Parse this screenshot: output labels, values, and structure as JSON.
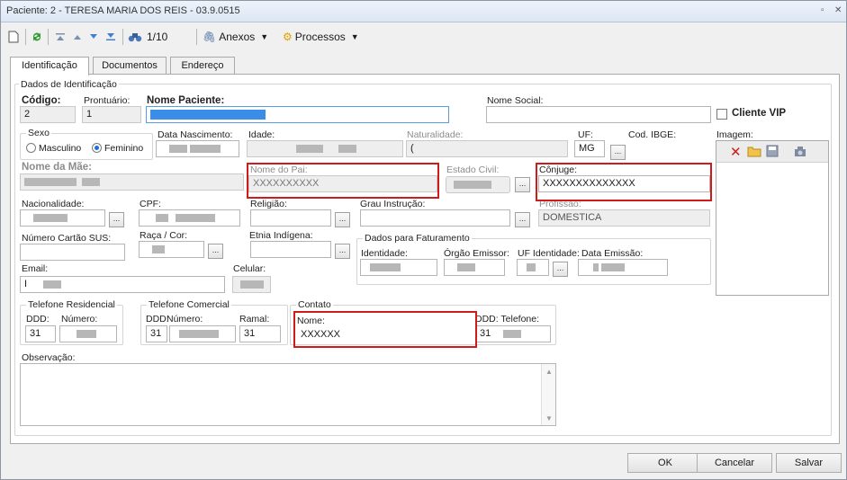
{
  "window": {
    "title": "Paciente: 2 - TERESA MARIA DOS REIS - 03.9.0515",
    "controls": [
      "▫",
      "✕"
    ]
  },
  "toolbar": {
    "record_position": "1/10",
    "anexos_label": "Anexos",
    "processos_label": "Processos"
  },
  "tabs": [
    "Identificação",
    "Documentos",
    "Endereço"
  ],
  "section_title": "Dados de Identificação",
  "fields": {
    "codigo_label": "Código:",
    "codigo_value": "2",
    "prontuario_label": "Prontuário:",
    "prontuario_value": "1",
    "nome_paciente_label": "Nome Paciente:",
    "nome_social_label": "Nome Social:",
    "cliente_vip_label": "Cliente VIP",
    "sexo_label": "Sexo",
    "masculino_label": "Masculino",
    "feminino_label": "Feminino",
    "data_nascimento_label": "Data Nascimento:",
    "idade_label": "Idade:",
    "idade_value_prefix": "",
    "naturalidade_label": "Naturalidade:",
    "naturalidade_value": "(",
    "uf_label": "UF:",
    "uf_value": "MG",
    "cod_ibge_label": "Cod. IBGE:",
    "imagem_label": "Imagem:",
    "nome_mae_label": "Nome da Mãe:",
    "nome_pai_label": "Nome do Pai:",
    "nome_pai_value": "XXXXXXXXXX",
    "estado_civil_label": "Estado Civil:",
    "conjuge_label": "Cônjuge:",
    "conjuge_value": "XXXXXXXXXXXXXX",
    "nacionalidade_label": "Nacionalidade:",
    "cpf_label": "CPF:",
    "religiao_label": "Religião:",
    "grau_instrucao_label": "Grau Instrução:",
    "profissao_label": "Profissão:",
    "profissao_value": "DOMESTICA",
    "cartao_sus_label": "Número Cartão SUS:",
    "raca_cor_label": "Raça / Cor:",
    "etnia_label": "Etnia Indígena:",
    "faturamento_title": "Dados para Faturamento",
    "identidade_label": "Identidade:",
    "orgao_emissor_label": "Órgão Emissor:",
    "uf_identidade_label": "UF Identidade:",
    "data_emissao_label": "Data Emissão:",
    "email_label": "Email:",
    "email_value": "I",
    "celular_label": "Celular:",
    "tel_residencial_title": "Telefone Residencial",
    "tel_comercial_title": "Telefone Comercial",
    "contato_title": "Contato",
    "ddd_label": "DDD:",
    "numero_label": "Número:",
    "ramal_label": "Ramal:",
    "ddd_res_value": "31",
    "ddd_com_value": "31",
    "ramal_value": "31",
    "contato_nome_label": "Nome:",
    "contato_nome_value": "XXXXXX",
    "ddd_telefone_label": "DDD: Telefone:",
    "ddd_contato_value": "31",
    "observacao_label": "Observação:"
  },
  "buttons": {
    "ok": "OK",
    "cancelar": "Cancelar",
    "salvar": "Salvar",
    "ellipsis": "..."
  },
  "colors": {
    "highlight_red": "#d11a1a",
    "focus_blue": "#569de5"
  },
  "icons": [
    "new-document-icon",
    "refresh-icon",
    "first-record-icon",
    "previous-record-icon",
    "next-record-icon",
    "last-record-icon",
    "search-binoculars-icon",
    "attachment-icon",
    "processes-icon",
    "delete-icon",
    "open-folder-icon",
    "save-icon",
    "camera-icon"
  ]
}
